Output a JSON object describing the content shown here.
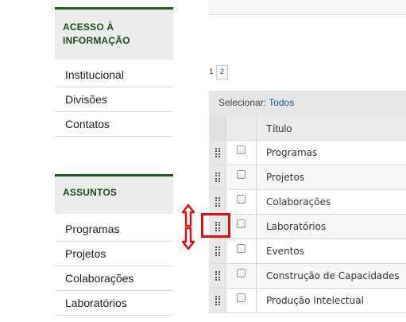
{
  "sidebar": {
    "block1": {
      "heading_line1": "ACESSO À",
      "heading_line2": "INFORMAÇÃO",
      "items": [
        "Institucional",
        "Divisões",
        "Contatos"
      ]
    },
    "block2": {
      "heading": "ASSUNTOS",
      "items": [
        "Programas",
        "Projetos",
        "Colaborações",
        "Laboratórios"
      ]
    }
  },
  "pager": {
    "current": "1",
    "next": "2"
  },
  "table": {
    "select_label": "Selecionar:",
    "select_all": "Todos",
    "title_header": "Título",
    "rows": [
      "Programas",
      "Projetos",
      "Colaborações",
      "Laboratórios",
      "Eventos",
      "Construção de Capacidades",
      "Produção Intelectual"
    ]
  },
  "colors": {
    "sidebar_accent": "#1e5c1e",
    "link": "#1a56a0",
    "annotation": "#e01010"
  }
}
